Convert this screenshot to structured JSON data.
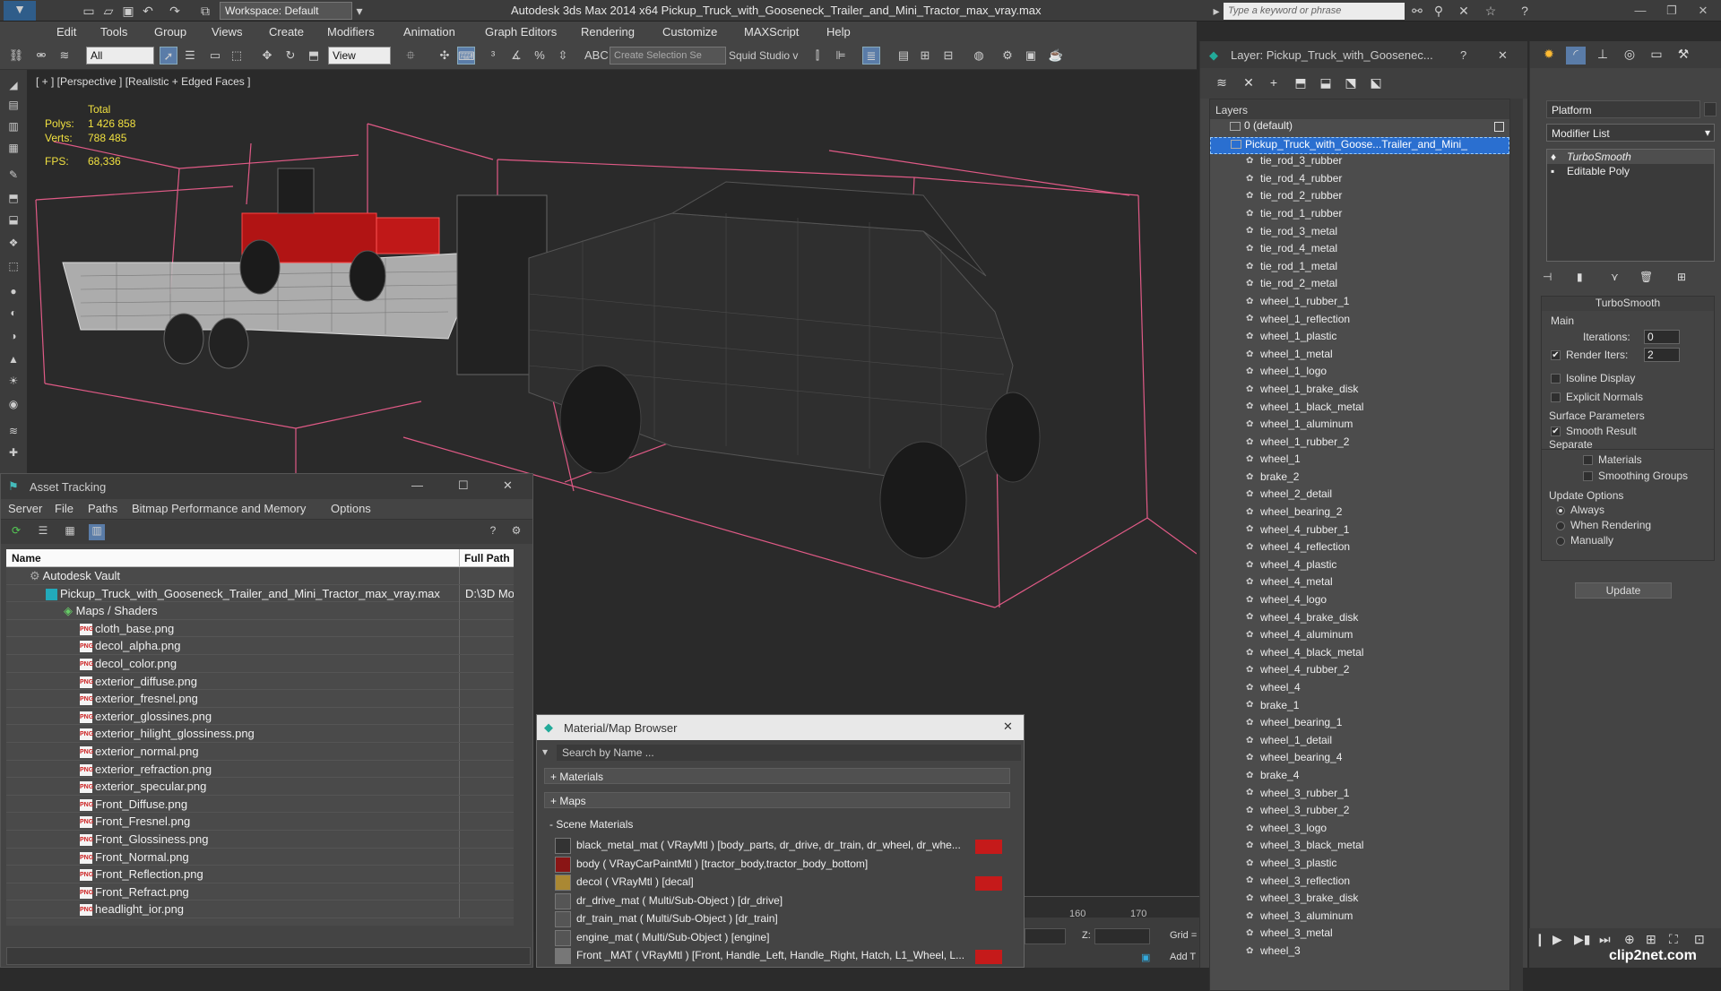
{
  "app": {
    "title": "Autodesk 3ds Max  2014 x64     Pickup_Truck_with_Gooseneck_Trailer_and_Mini_Tractor_max_vray.max",
    "workspace": "Workspace: Default",
    "search_placeholder": "Type a keyword or phrase"
  },
  "menu": [
    "Edit",
    "Tools",
    "Group",
    "Views",
    "Create",
    "Modifiers",
    "Animation",
    "Graph Editors",
    "Rendering",
    "Customize",
    "MAXScript",
    "Help"
  ],
  "toolbar": {
    "filter_value": "All",
    "ref_coord": "View",
    "selection_set_placeholder": "Create Selection Se",
    "squid": "Squid Studio v"
  },
  "viewport": {
    "label": "[ + ] [Perspective ] [Realistic + Edged Faces ]",
    "stats_header": "Total",
    "polys_label": "Polys:",
    "polys_value": "1 426 858",
    "verts_label": "Verts:",
    "verts_value": "788 485",
    "fps_label": "FPS:",
    "fps_value": "68,336"
  },
  "asset_tracking": {
    "title": "Asset Tracking",
    "menu": [
      "Server",
      "File",
      "Paths",
      "Bitmap Performance and Memory",
      "Options"
    ],
    "col_name": "Name",
    "col_path": "Full Path",
    "vault": "Autodesk Vault",
    "file": "Pickup_Truck_with_Gooseneck_Trailer_and_Mini_Tractor_max_vray.max",
    "file_path": "D:\\3D Mo",
    "maps_group": "Maps / Shaders",
    "png_icon": "PNG",
    "maps": [
      "cloth_base.png",
      "decol_alpha.png",
      "decol_color.png",
      "exterior_diffuse.png",
      "exterior_fresnel.png",
      "exterior_glossines.png",
      "exterior_hilight_glossiness.png",
      "exterior_normal.png",
      "exterior_refraction.png",
      "exterior_specular.png",
      "Front_Diffuse.png",
      "Front_Fresnel.png",
      "Front_Glossiness.png",
      "Front_Normal.png",
      "Front_Reflection.png",
      "Front_Refract.png",
      "headlight_ior.png"
    ]
  },
  "material_browser": {
    "title": "Material/Map Browser",
    "search_placeholder": "Search by Name ...",
    "groups": [
      "+ Materials",
      "+ Maps",
      "- Scene Materials"
    ],
    "materials": [
      "black_metal_mat  ( VRayMtl ) [body_parts, dr_drive, dr_train, dr_wheel, dr_whe...",
      "body  ( VRayCarPaintMtl ) [tractor_body,tractor_body_bottom]",
      "decol  ( VRayMtl ) [decal]",
      "dr_drive_mat  ( Multi/Sub-Object ) [dr_drive]",
      "dr_train_mat  ( Multi/Sub-Object ) [dr_train]",
      "engine_mat  ( Multi/Sub-Object ) [engine]",
      "Front _MAT  ( VRayMtl ) [Front, Handle_Left, Handle_Right, Hatch, L1_Wheel, L..."
    ]
  },
  "layers": {
    "title": "Layer: Pickup_Truck_with_Goosenec...",
    "header": "Layers",
    "default_layer": "0 (default)",
    "selected_layer": "Pickup_Truck_with_Goose...Trailer_and_Mini_",
    "items": [
      "tie_rod_3_rubber",
      "tie_rod_4_rubber",
      "tie_rod_2_rubber",
      "tie_rod_1_rubber",
      "tie_rod_3_metal",
      "tie_rod_4_metal",
      "tie_rod_1_metal",
      "tie_rod_2_metal",
      "wheel_1_rubber_1",
      "wheel_1_reflection",
      "wheel_1_plastic",
      "wheel_1_metal",
      "wheel_1_logo",
      "wheel_1_brake_disk",
      "wheel_1_black_metal",
      "wheel_1_aluminum",
      "wheel_1_rubber_2",
      "wheel_1",
      "brake_2",
      "wheel_2_detail",
      "wheel_bearing_2",
      "wheel_4_rubber_1",
      "wheel_4_reflection",
      "wheel_4_plastic",
      "wheel_4_metal",
      "wheel_4_logo",
      "wheel_4_brake_disk",
      "wheel_4_aluminum",
      "wheel_4_black_metal",
      "wheel_4_rubber_2",
      "wheel_4",
      "brake_1",
      "wheel_bearing_1",
      "wheel_1_detail",
      "wheel_bearing_4",
      "brake_4",
      "wheel_3_rubber_1",
      "wheel_3_rubber_2",
      "wheel_3_logo",
      "wheel_3_black_metal",
      "wheel_3_plastic",
      "wheel_3_reflection",
      "wheel_3_brake_disk",
      "wheel_3_aluminum",
      "wheel_3_metal",
      "wheel_3"
    ]
  },
  "command_panel": {
    "object_name": "Platform",
    "modifier_list": "Modifier List",
    "stack": [
      "TurboSmooth",
      "Editable Poly"
    ],
    "turbosmooth": {
      "title": "TurboSmooth",
      "main": "Main",
      "iterations_label": "Iterations:",
      "iterations_value": "0",
      "render_iters_label": "Render Iters:",
      "render_iters_value": "2",
      "isoline": "Isoline Display",
      "explicit_normals": "Explicit Normals",
      "surface_params": "Surface Parameters",
      "smooth_result": "Smooth Result",
      "separate": "Separate",
      "materials": "Materials",
      "smoothing_groups": "Smoothing Groups",
      "update_options": "Update Options",
      "always": "Always",
      "when_rendering": "When Rendering",
      "manually": "Manually",
      "update_button": "Update"
    }
  },
  "timeline": {
    "tick_160": "160",
    "tick_170": "170",
    "z_label": "Z:",
    "grid_label": "Grid =",
    "add_label": "Add T"
  },
  "watermark": "clip2net.com"
}
